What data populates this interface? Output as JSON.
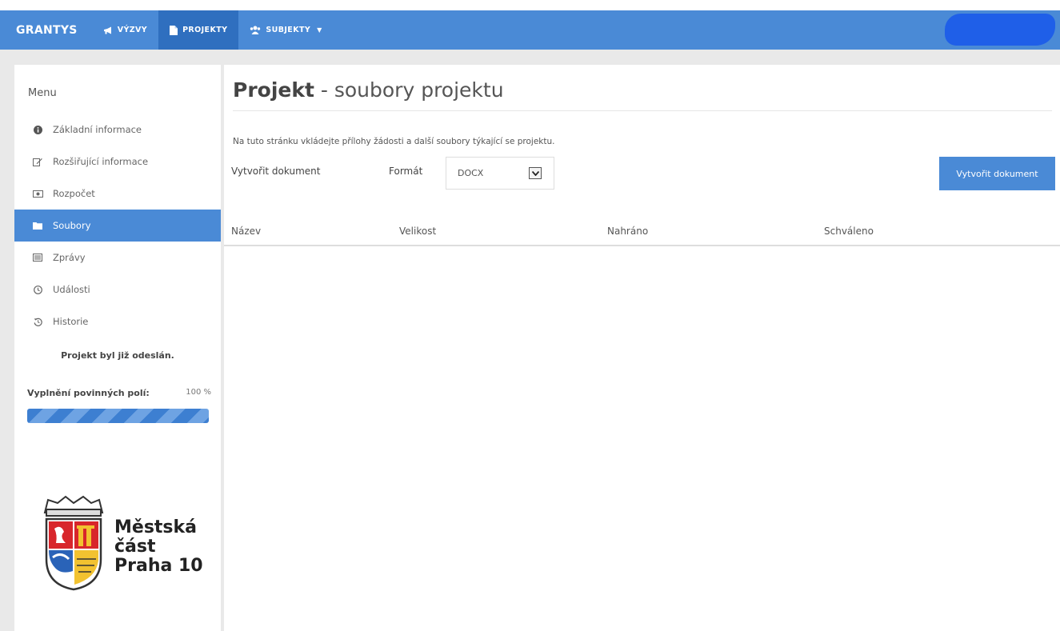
{
  "navbar": {
    "brand": "GRANTYS",
    "items": [
      {
        "label": "VÝZVY",
        "icon": "megaphone-icon",
        "active": false
      },
      {
        "label": "PROJEKTY",
        "icon": "file-icon",
        "active": true
      },
      {
        "label": "SUBJEKTY",
        "icon": "users-icon",
        "active": false,
        "dropdown": true
      }
    ],
    "caret": "▼",
    "accent_color": "#4a8ad6",
    "active_color": "#2f6fbf"
  },
  "sidebar": {
    "menu_title": "Menu",
    "items": [
      {
        "label": "Základní informace",
        "icon": "info-circle-icon",
        "active": false
      },
      {
        "label": "Rozšiřující informace",
        "icon": "edit-icon",
        "active": false
      },
      {
        "label": "Rozpočet",
        "icon": "money-icon",
        "active": false
      },
      {
        "label": "Soubory",
        "icon": "folder-icon",
        "active": true
      },
      {
        "label": "Zprávy",
        "icon": "list-icon",
        "active": false
      },
      {
        "label": "Události",
        "icon": "clock-icon",
        "active": false
      },
      {
        "label": "Historie",
        "icon": "history-icon",
        "active": false
      }
    ],
    "sent_note": "Projekt byl již odeslán.",
    "fill_label": "Vyplnění povinných polí:",
    "fill_value": "100 %",
    "fill_fraction": 1.0,
    "logo": {
      "line1": "Městská",
      "line2": "část",
      "line3": "Praha 10"
    }
  },
  "main": {
    "title_strong": "Projekt",
    "title_rest": " - soubory projektu",
    "intro": "Na tuto stránku vkládejte přílohy žádosti a další soubory týkající se projektu.",
    "create_label": "Vytvořit dokument",
    "format_label": "Formát",
    "format_value": "DOCX",
    "create_button": "Vytvořit dokument",
    "table_headers": [
      "Název",
      "Velikost",
      "Nahráno",
      "Schváleno"
    ]
  }
}
